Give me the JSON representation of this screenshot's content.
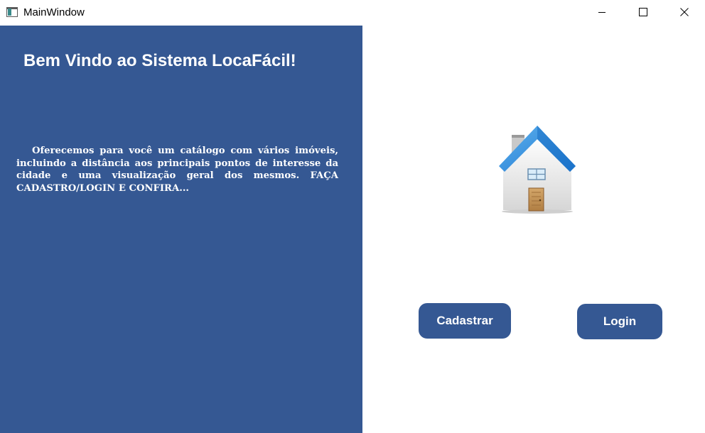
{
  "window": {
    "title": "MainWindow",
    "icon": "app-window-icon",
    "controls": {
      "minimize_icon": "minimize-icon",
      "maximize_icon": "maximize-icon",
      "close_icon": "close-icon"
    }
  },
  "left_panel": {
    "background_color": "#355893",
    "heading": "Bem Vindo ao Sistema LocaFácil!",
    "description": "Oferecemos para você um catálogo  com vários imóveis, incluindo a distância aos principais pontos de interesse da cidade e uma visualização geral dos mesmos. FAÇA CADASTRO/LOGIN E CONFIRA..."
  },
  "right_panel": {
    "image_icon": "house-icon",
    "buttons": {
      "cadastrar_label": "Cadastrar",
      "login_label": "Login"
    },
    "button_color": "#355893"
  }
}
